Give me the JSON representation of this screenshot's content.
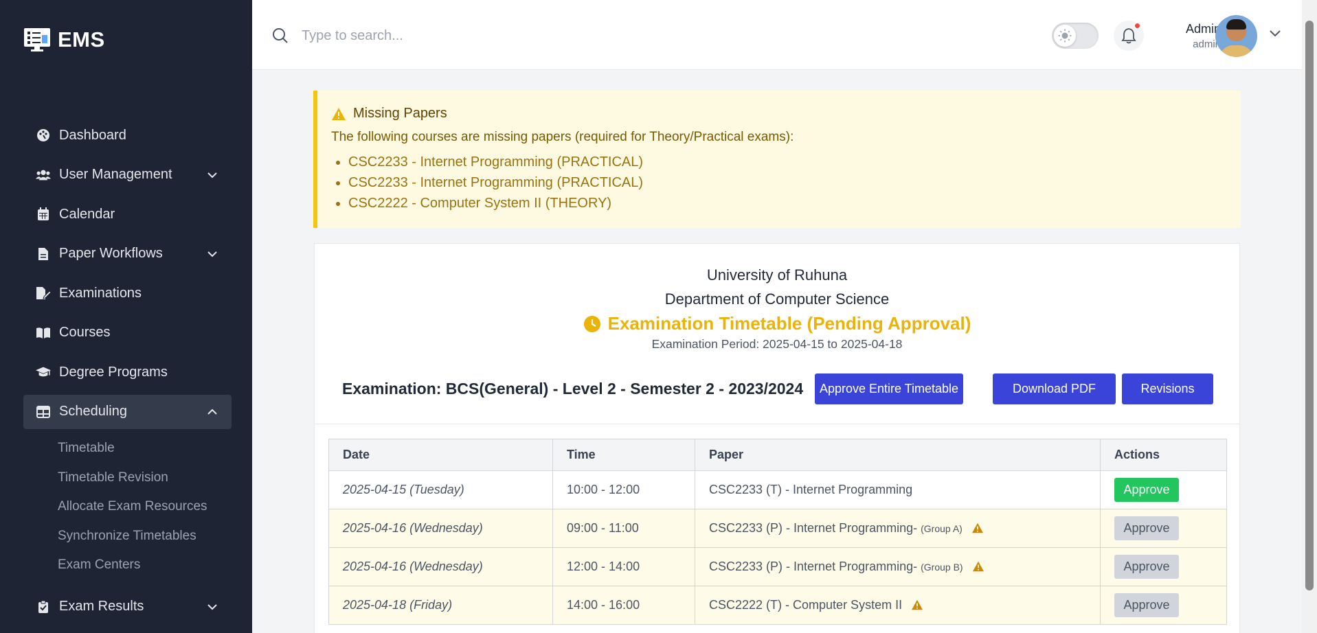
{
  "app": {
    "brand": "EMS"
  },
  "sidebar": {
    "items": [
      {
        "label": "Dashboard",
        "icon": "palette-icon"
      },
      {
        "label": "User Management",
        "icon": "users-icon",
        "expandable": true
      },
      {
        "label": "Calendar",
        "icon": "calendar-icon"
      },
      {
        "label": "Paper Workflows",
        "icon": "file-icon",
        "expandable": true
      },
      {
        "label": "Examinations",
        "icon": "file-edit-icon"
      },
      {
        "label": "Courses",
        "icon": "book-icon"
      },
      {
        "label": "Degree Programs",
        "icon": "graduation-cap-icon"
      },
      {
        "label": "Scheduling",
        "icon": "table-icon",
        "expanded": true,
        "active": true
      }
    ],
    "scheduling_sub": [
      "Timetable",
      "Timetable Revision",
      "Allocate Exam Resources",
      "Synchronize Timetables",
      "Exam Centers"
    ],
    "exam_results": {
      "label": "Exam Results",
      "icon": "clipboard-check-icon"
    }
  },
  "header": {
    "search_placeholder": "Type to search...",
    "user": {
      "name": "Admin",
      "role": "admin"
    }
  },
  "alert": {
    "title": "Missing Papers",
    "description": "The following courses are missing papers (required for Theory/Practical exams):",
    "items": [
      "CSC2233 - Internet Programming (PRACTICAL)",
      "CSC2233 - Internet Programming (PRACTICAL)",
      "CSC2222 - Computer System II (THEORY)"
    ]
  },
  "card": {
    "university": "University of Ruhuna",
    "department": "Department of Computer Science",
    "title": "Examination Timetable (Pending Approval)",
    "period": "Examination Period: 2025-04-15 to 2025-04-18",
    "exam": "Examination: BCS(General) - Level 2 - Semester 2 - 2023/2024",
    "buttons": {
      "approve_all": "Approve Entire Timetable",
      "download": "Download PDF",
      "revisions": "Revisions"
    }
  },
  "table": {
    "headers": [
      "Date",
      "Time",
      "Paper",
      "Actions"
    ],
    "rows": [
      {
        "date": "2025-04-15 (Tuesday)",
        "time": "10:00 - 12:00",
        "paper": "CSC2233 (T) - Internet Programming",
        "group": "",
        "warning": false,
        "action": "Approve",
        "action_state": "enabled"
      },
      {
        "date": "2025-04-16 (Wednesday)",
        "time": "09:00 - 11:00",
        "paper": "CSC2233 (P) - Internet Programming-",
        "group": "(Group A)",
        "warning": true,
        "action": "Approve",
        "action_state": "disabled"
      },
      {
        "date": "2025-04-16 (Wednesday)",
        "time": "12:00 - 14:00",
        "paper": "CSC2233 (P) - Internet Programming-",
        "group": "(Group B)",
        "warning": true,
        "action": "Approve",
        "action_state": "disabled"
      },
      {
        "date": "2025-04-18 (Friday)",
        "time": "14:00 - 16:00",
        "paper": "CSC2222 (T) - Computer System II",
        "group": "",
        "warning": true,
        "action": "Approve",
        "action_state": "disabled"
      }
    ]
  },
  "colors": {
    "sidebar_bg": "#1e2433",
    "primary": "#3b44d8",
    "success": "#22c55e",
    "warning": "#eab308",
    "alert_bg": "#fef9e1"
  }
}
